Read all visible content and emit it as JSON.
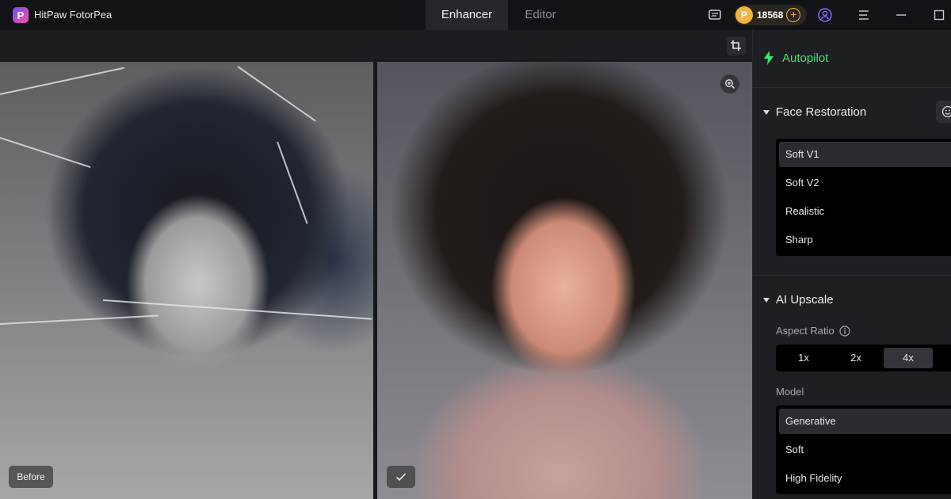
{
  "app": {
    "title": "HitPaw FotorPea",
    "logo_letter": "P",
    "coins": "18568"
  },
  "tabs": [
    {
      "label": "Enhancer",
      "active": true
    },
    {
      "label": "Editor",
      "active": false
    }
  ],
  "canvas": {
    "before_label": "Before"
  },
  "panel": {
    "autopilot_label": "Autopilot",
    "face_restoration": {
      "title": "Face Restoration",
      "options": [
        "Soft V1",
        "Soft V2",
        "Realistic",
        "Sharp"
      ],
      "selected": "Soft V1"
    },
    "ai_upscale": {
      "title": "AI Upscale",
      "aspect_ratio_label": "Aspect Ratio",
      "ratios": [
        "1x",
        "2x",
        "4x"
      ],
      "selected_ratio": "4x",
      "model_label": "Model",
      "models": [
        "Generative",
        "Soft",
        "High Fidelity"
      ],
      "selected_model": "Generative"
    }
  },
  "colors": {
    "accent_green": "#3ee86a",
    "coin_gold": "#f0b441",
    "background": "#17181c"
  },
  "icons": [
    "message-icon",
    "coin-icon",
    "plus-icon",
    "user-icon",
    "menu-icon",
    "minimize-icon",
    "maximize-icon",
    "crop-icon",
    "zoom-in-icon",
    "check-icon",
    "bolt-icon",
    "info-icon",
    "face-icon"
  ]
}
